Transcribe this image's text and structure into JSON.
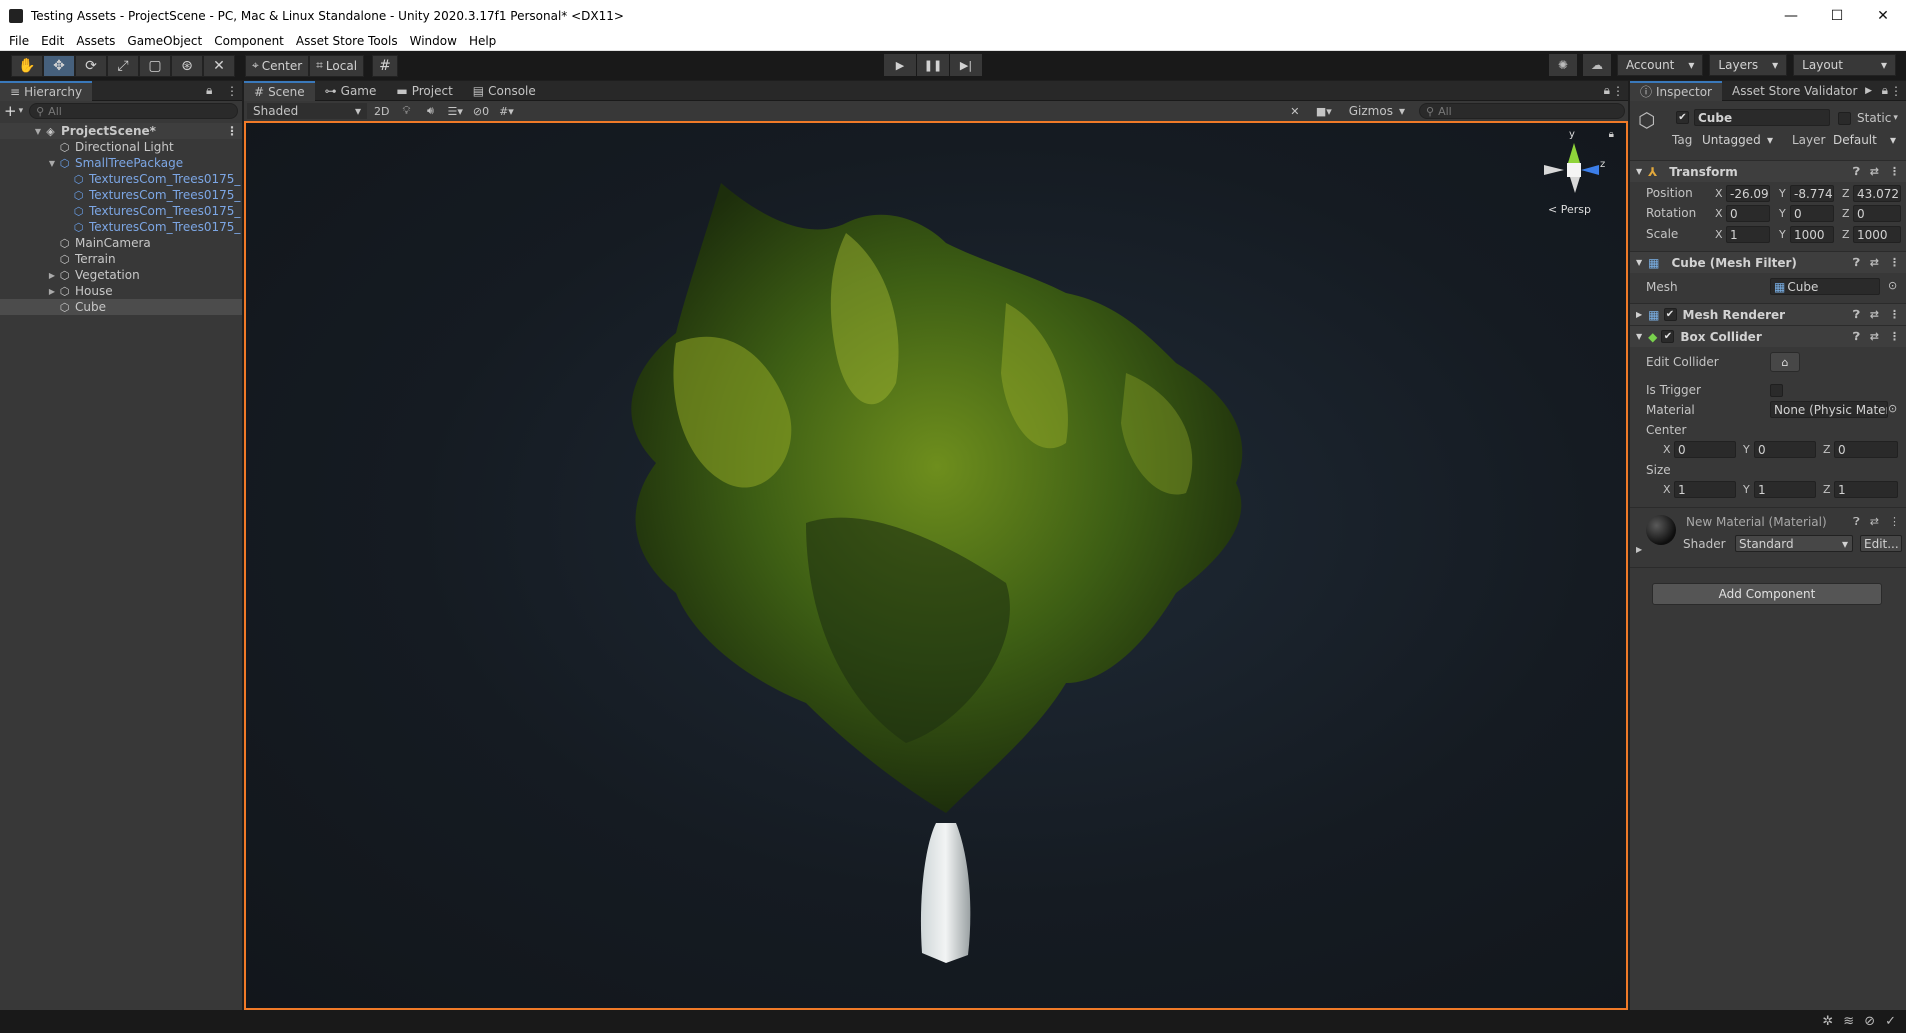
{
  "window": {
    "title": "Testing Assets - ProjectScene - PC, Mac & Linux Standalone - Unity 2020.3.17f1 Personal* <DX11>",
    "minimize": "—",
    "maximize": "☐",
    "close": "✕"
  },
  "menu": [
    "File",
    "Edit",
    "Assets",
    "GameObject",
    "Component",
    "Asset Store Tools",
    "Window",
    "Help"
  ],
  "toolbar": {
    "tools": [
      "hand-tool",
      "move-tool",
      "rotate-tool",
      "scale-tool",
      "rect-tool",
      "transform-tool",
      "custom-tool"
    ],
    "active_tool": "move-tool",
    "pivot": "Center",
    "space": "Local",
    "account": "Account",
    "layers": "Layers",
    "layout": "Layout"
  },
  "hierarchy": {
    "tab": "Hierarchy",
    "add": "+",
    "search_placeholder": "All",
    "scene": "ProjectScene*",
    "items": [
      {
        "label": "Directional Light",
        "depth": 1,
        "arrow": "",
        "prefab": false
      },
      {
        "label": "SmallTreePackage",
        "depth": 1,
        "arrow": "▼",
        "prefab": true
      },
      {
        "label": "TexturesCom_Trees0175_",
        "depth": 2,
        "arrow": "",
        "prefab": true
      },
      {
        "label": "TexturesCom_Trees0175_",
        "depth": 2,
        "arrow": "",
        "prefab": true
      },
      {
        "label": "TexturesCom_Trees0175_",
        "depth": 2,
        "arrow": "",
        "prefab": true
      },
      {
        "label": "TexturesCom_Trees0175_",
        "depth": 2,
        "arrow": "",
        "prefab": true
      },
      {
        "label": "MainCamera",
        "depth": 1,
        "arrow": "",
        "prefab": false
      },
      {
        "label": "Terrain",
        "depth": 1,
        "arrow": "",
        "prefab": false
      },
      {
        "label": "Vegetation",
        "depth": 1,
        "arrow": "▶",
        "prefab": false
      },
      {
        "label": "House",
        "depth": 1,
        "arrow": "▶",
        "prefab": false
      },
      {
        "label": "Cube",
        "depth": 1,
        "arrow": "",
        "prefab": false,
        "selected": true
      }
    ]
  },
  "scene": {
    "tabs": [
      "Scene",
      "Game",
      "Project",
      "Console"
    ],
    "shading": "Shaded",
    "mode_2d": "2D",
    "hidden_count": "0",
    "gizmos": "Gizmos",
    "search_placeholder": "All",
    "gizmo_y": "y",
    "gizmo_z": "z",
    "persp": "Persp"
  },
  "inspector": {
    "tabs": [
      "Inspector",
      "Asset Store Validator"
    ],
    "object_name": "Cube",
    "static": "Static",
    "tag_label": "Tag",
    "tag": "Untagged",
    "layer_label": "Layer",
    "layer": "Default",
    "transform": {
      "title": "Transform",
      "position_label": "Position",
      "rotation_label": "Rotation",
      "scale_label": "Scale",
      "position": [
        "-26.094",
        "-8.7745",
        "43.072"
      ],
      "rotation": [
        "0",
        "0",
        "0"
      ],
      "scale": [
        "1",
        "1000",
        "1000"
      ]
    },
    "mesh_filter": {
      "title": "Cube (Mesh Filter)",
      "mesh_label": "Mesh",
      "mesh": "Cube"
    },
    "mesh_renderer": {
      "title": "Mesh Renderer"
    },
    "box_collider": {
      "title": "Box Collider",
      "edit_collider": "Edit Collider",
      "is_trigger": "Is Trigger",
      "material_label": "Material",
      "material": "None (Physic Mater",
      "center_label": "Center",
      "center": [
        "0",
        "0",
        "0"
      ],
      "size_label": "Size",
      "size": [
        "1",
        "1",
        "1"
      ]
    },
    "material": {
      "title": "New Material (Material)",
      "shader_label": "Shader",
      "shader": "Standard",
      "edit": "Edit..."
    },
    "add_component": "Add Component",
    "axes": [
      "X",
      "Y",
      "Z"
    ]
  },
  "colors": {
    "selection_outline": "#f07a28",
    "accent": "#3a79bb",
    "prefab_text": "#7ca6e4"
  }
}
